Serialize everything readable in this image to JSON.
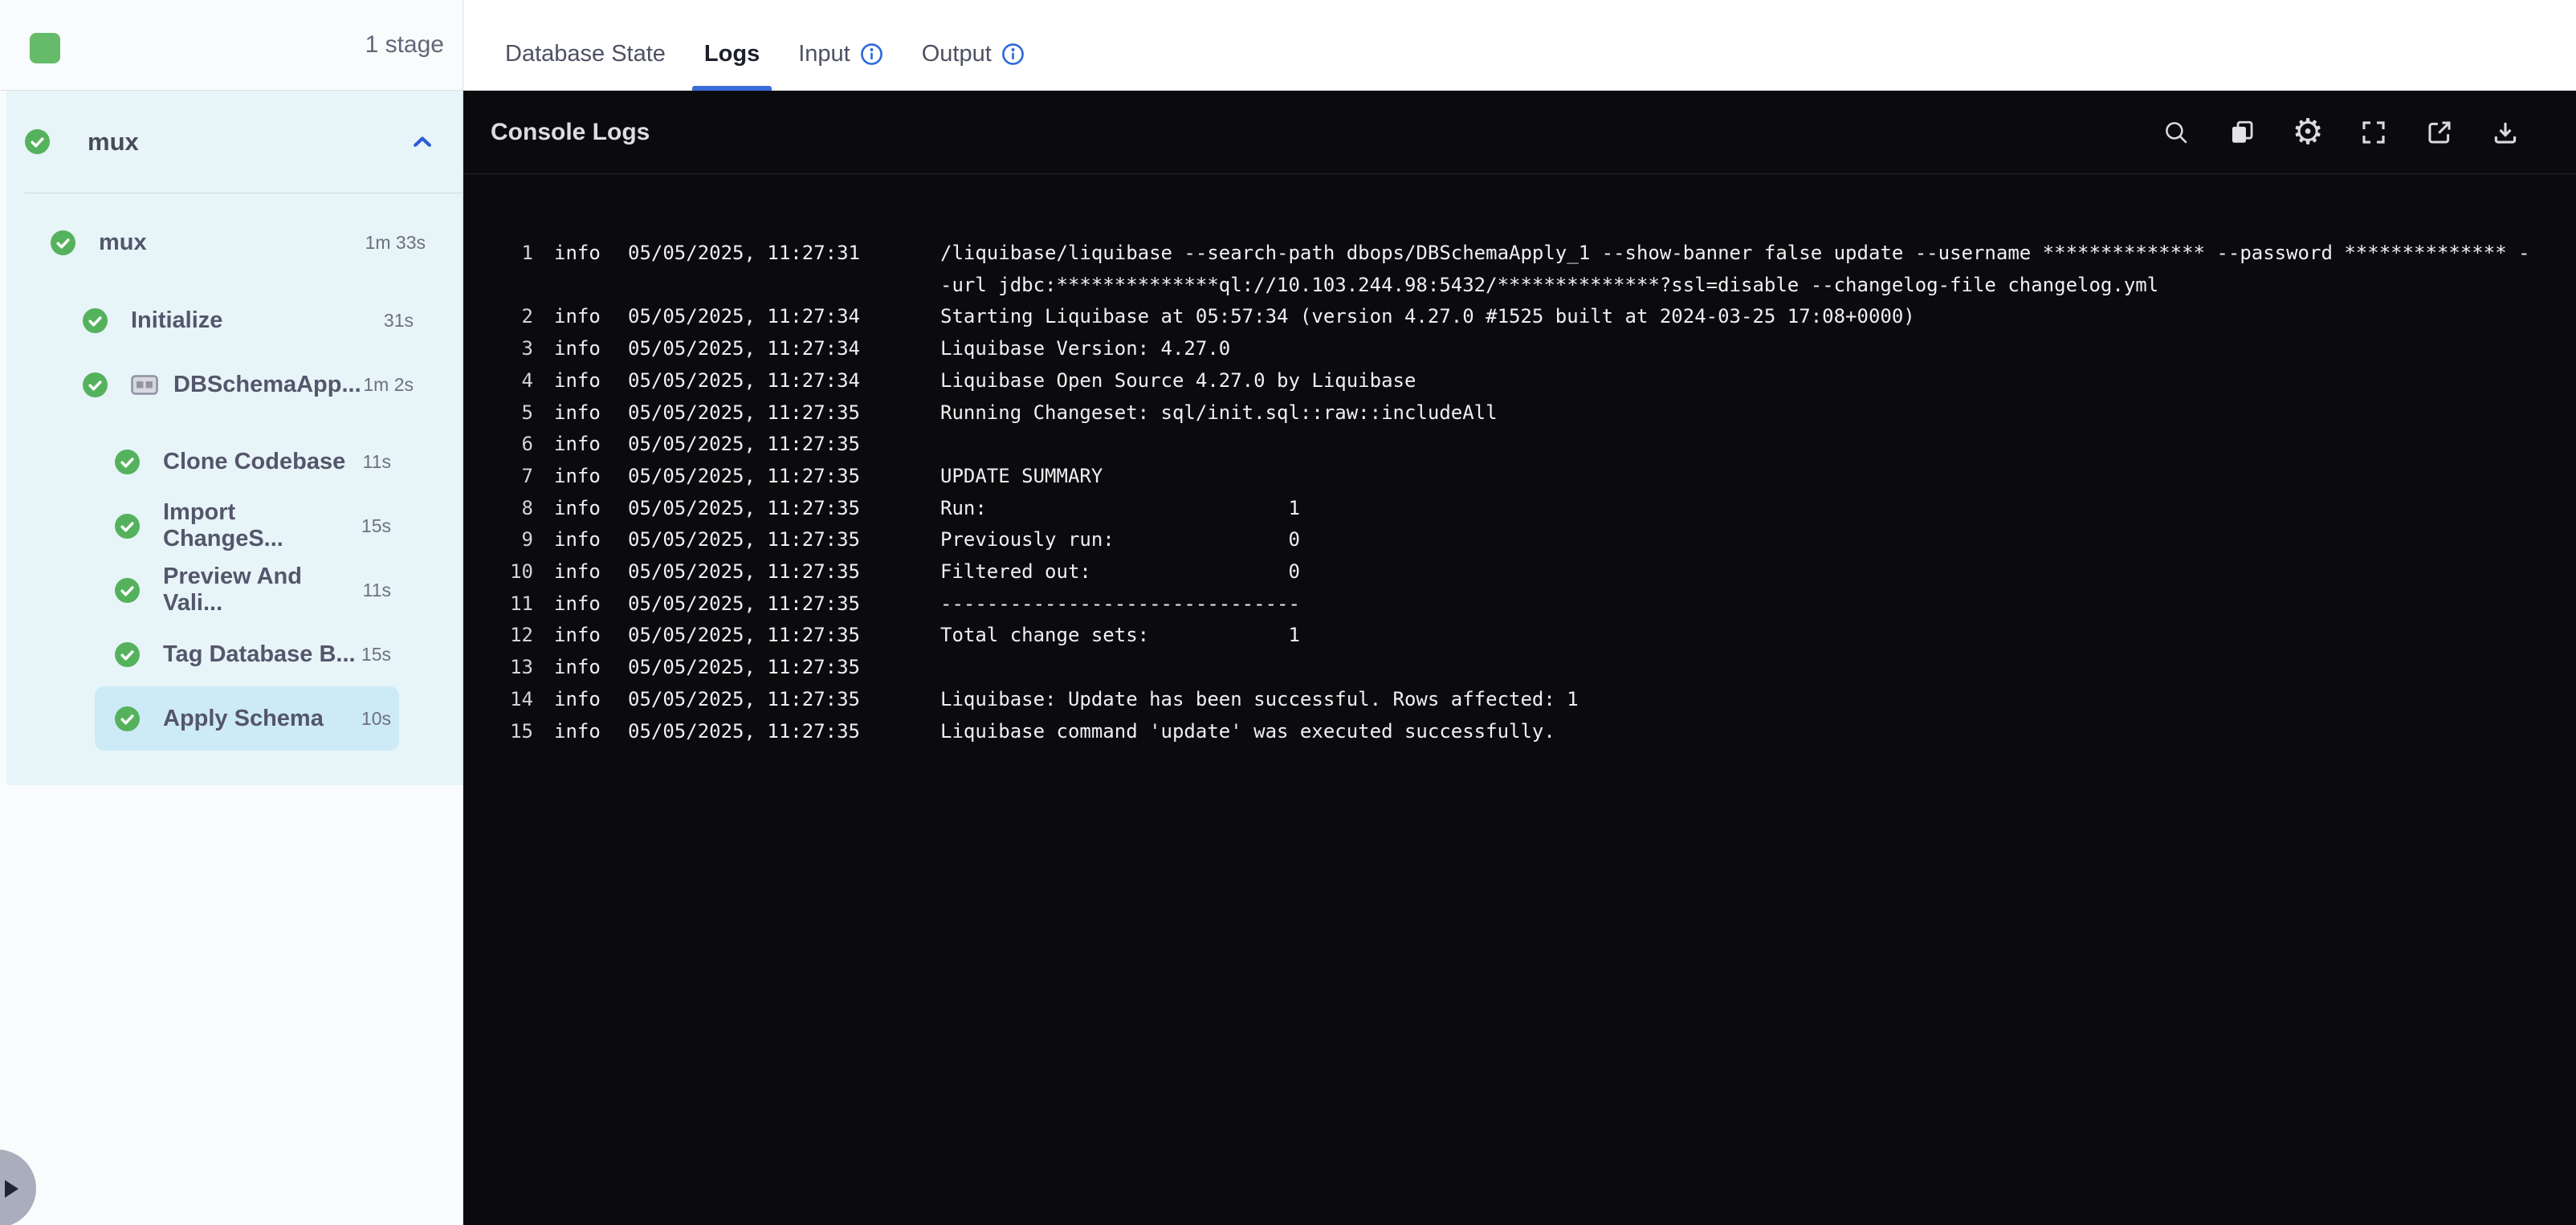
{
  "header": {
    "stage_count": "1 stage"
  },
  "tabs": {
    "database_state": "Database State",
    "logs": "Logs",
    "input": "Input",
    "output": "Output"
  },
  "sidebar": {
    "root_label": "mux",
    "tree": [
      {
        "label": "mux",
        "duration": "1m 33s"
      },
      {
        "label": "Initialize",
        "duration": "31s"
      },
      {
        "label": "DBSchemaApp...",
        "duration": "1m 2s"
      },
      {
        "label": "Clone Codebase",
        "duration": "11s"
      },
      {
        "label": "Import ChangeS...",
        "duration": "15s"
      },
      {
        "label": "Preview And Vali...",
        "duration": "11s"
      },
      {
        "label": "Tag Database B...",
        "duration": "15s"
      },
      {
        "label": "Apply Schema",
        "duration": "10s"
      }
    ]
  },
  "console": {
    "title": "Console Logs",
    "toolbar_icons": [
      "search",
      "copy",
      "settings",
      "fullscreen",
      "open-in-new",
      "download"
    ],
    "logs": [
      {
        "num": "1",
        "level": "info",
        "timestamp": "05/05/2025, 11:27:31",
        "message": "/liquibase/liquibase --search-path dbops/DBSchemaApply_1 --show-banner false update --username ************** --password ************** --url jdbc:**************ql://10.103.244.98:5432/**************?ssl=disable --changelog-file changelog.yml"
      },
      {
        "num": "2",
        "level": "info",
        "timestamp": "05/05/2025, 11:27:34",
        "message": "Starting Liquibase at 05:57:34 (version 4.27.0 #1525 built at 2024-03-25 17:08+0000)"
      },
      {
        "num": "3",
        "level": "info",
        "timestamp": "05/05/2025, 11:27:34",
        "message": "Liquibase Version: 4.27.0"
      },
      {
        "num": "4",
        "level": "info",
        "timestamp": "05/05/2025, 11:27:34",
        "message": "Liquibase Open Source 4.27.0 by Liquibase"
      },
      {
        "num": "5",
        "level": "info",
        "timestamp": "05/05/2025, 11:27:35",
        "message": "Running Changeset: sql/init.sql::raw::includeAll"
      },
      {
        "num": "6",
        "level": "info",
        "timestamp": "05/05/2025, 11:27:35",
        "message": ""
      },
      {
        "num": "7",
        "level": "info",
        "timestamp": "05/05/2025, 11:27:35",
        "message": "UPDATE SUMMARY"
      },
      {
        "num": "8",
        "level": "info",
        "timestamp": "05/05/2025, 11:27:35",
        "message": "Run:                          1"
      },
      {
        "num": "9",
        "level": "info",
        "timestamp": "05/05/2025, 11:27:35",
        "message": "Previously run:               0"
      },
      {
        "num": "10",
        "level": "info",
        "timestamp": "05/05/2025, 11:27:35",
        "message": "Filtered out:                 0"
      },
      {
        "num": "11",
        "level": "info",
        "timestamp": "05/05/2025, 11:27:35",
        "message": "-------------------------------"
      },
      {
        "num": "12",
        "level": "info",
        "timestamp": "05/05/2025, 11:27:35",
        "message": "Total change sets:            1"
      },
      {
        "num": "13",
        "level": "info",
        "timestamp": "05/05/2025, 11:27:35",
        "message": ""
      },
      {
        "num": "14",
        "level": "info",
        "timestamp": "05/05/2025, 11:27:35",
        "message": "Liquibase: Update has been successful. Rows affected: 1"
      },
      {
        "num": "15",
        "level": "info",
        "timestamp": "05/05/2025, 11:27:35",
        "message": "Liquibase command 'update' was executed successfully."
      }
    ]
  },
  "colors": {
    "success_green": "#55b25c",
    "stage_square_green": "#66bb6a",
    "accent_blue": "#3a6bd8",
    "selected_row_bg": "#cdeaf7",
    "tree_panel_bg": "#e7f4f8",
    "console_bg": "#0b0b0d"
  }
}
